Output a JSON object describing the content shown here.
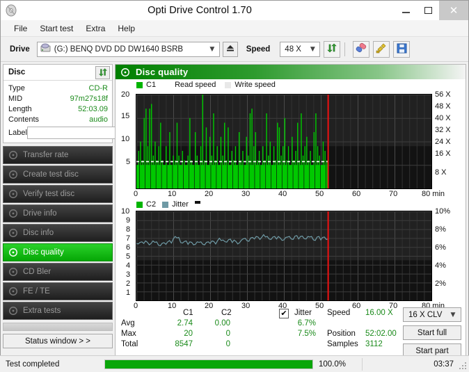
{
  "window": {
    "title": "Opti Drive Control 1.70",
    "app_icon": "disc-icon",
    "minimize": "minimize-icon",
    "maximize": "maximize-icon",
    "close": "close-icon"
  },
  "menu": {
    "items": [
      "File",
      "Start test",
      "Extra",
      "Help"
    ]
  },
  "toolbar": {
    "drive_label": "Drive",
    "drive_value": "(G:)   BENQ DVD DD DW1640 BSRB",
    "eject_icon": "eject-icon",
    "speed_label": "Speed",
    "speed_value": "48 X",
    "refresh_icon": "refresh-arrows-icon",
    "erase_icon": "eraser-icon",
    "tools_icon": "plug-icon",
    "save_icon": "floppy-save-icon"
  },
  "disc_panel": {
    "title": "Disc",
    "refresh_icon": "refresh-arrows-icon",
    "rows": [
      {
        "key": "Type",
        "value": "CD-R"
      },
      {
        "key": "MID",
        "value": "97m27s18f"
      },
      {
        "key": "Length",
        "value": "52:03.09"
      },
      {
        "key": "Contents",
        "value": "audio"
      }
    ],
    "label_key": "Label",
    "label_value": "",
    "label_placeholder": "",
    "label_button_icon": "cd-disc-icon"
  },
  "nav": {
    "items": [
      {
        "label": "Transfer rate",
        "icon": "disc-test-icon",
        "active": false
      },
      {
        "label": "Create test disc",
        "icon": "disc-burn-icon",
        "active": false
      },
      {
        "label": "Verify test disc",
        "icon": "disc-verify-icon",
        "active": false
      },
      {
        "label": "Drive info",
        "icon": "disc-drive-icon",
        "active": false
      },
      {
        "label": "Disc info",
        "icon": "disc-info-icon",
        "active": false
      },
      {
        "label": "Disc quality",
        "icon": "disc-quality-icon",
        "active": true
      },
      {
        "label": "CD Bler",
        "icon": "disc-bler-icon",
        "active": false
      },
      {
        "label": "FE / TE",
        "icon": "disc-fete-icon",
        "active": false
      },
      {
        "label": "Extra tests",
        "icon": "disc-extra-icon",
        "active": false
      }
    ],
    "status_window_label": "Status window > >"
  },
  "panel": {
    "title": "Disc quality",
    "icon": "disc-quality-icon"
  },
  "chart_data": [
    {
      "id": "c1-chart",
      "type": "bar",
      "title": "C1 / Read speed",
      "legend": [
        {
          "label": "C1",
          "color": "#00b400"
        },
        {
          "label": "Read speed",
          "color": "#ffffff"
        },
        {
          "label": "Write speed",
          "color": "#e8e8e8"
        }
      ],
      "legend_position": "top-left",
      "xlabel": "min",
      "xlim": [
        0,
        80
      ],
      "xticks": [
        0,
        10,
        20,
        30,
        40,
        50,
        60,
        70,
        80
      ],
      "xticklabels": [
        "0",
        "10",
        "20",
        "30",
        "40",
        "50",
        "60",
        "70",
        "80 min"
      ],
      "ylabel": "",
      "ylim": [
        0,
        20
      ],
      "yticks": [
        5,
        10,
        15,
        20
      ],
      "yticklabels": [
        "5",
        "10",
        "15",
        "20"
      ],
      "y2label": "",
      "y2lim": [
        0,
        56
      ],
      "y2ticks": [
        8,
        16,
        24,
        32,
        40,
        48,
        56
      ],
      "y2ticklabels": [
        "8 X",
        "16 X",
        "24 X",
        "32 X",
        "40 X",
        "48 X",
        "56 X"
      ],
      "grid": true,
      "marker_line_x": 52,
      "data_end_x": 52,
      "series": [
        {
          "name": "C1",
          "color": "#00c800",
          "x": [
            0,
            0.5,
            1,
            1.5,
            2,
            2.5,
            3,
            3.5,
            4,
            4.5,
            5,
            5.5,
            6,
            6.5,
            7,
            7.5,
            8,
            8.5,
            9,
            9.5,
            10,
            10.5,
            11,
            11.5,
            12,
            12.5,
            13,
            13.5,
            14,
            14.5,
            15,
            15.5,
            16,
            16.5,
            17,
            17.5,
            18,
            18.5,
            19,
            19.5,
            20,
            20.5,
            21,
            21.5,
            22,
            22.5,
            23,
            23.5,
            24,
            24.5,
            25,
            25.5,
            26,
            26.5,
            27,
            27.5,
            28,
            28.5,
            29,
            29.5,
            30,
            30.5,
            31,
            31.5,
            32,
            32.5,
            33,
            33.5,
            34,
            34.5,
            35,
            35.5,
            36,
            36.5,
            37,
            37.5,
            38,
            38.5,
            39,
            39.5,
            40,
            40.5,
            41,
            41.5,
            42,
            42.5,
            43,
            43.5,
            44,
            44.5,
            45,
            45.5,
            46,
            46.5,
            47,
            47.5,
            48,
            48.5,
            49,
            49.5,
            50,
            50.5,
            51,
            51.5,
            52
          ],
          "values": [
            5,
            8,
            10,
            6,
            15,
            17,
            9,
            17,
            18,
            7,
            10,
            6,
            9,
            14,
            6,
            5,
            9,
            4,
            12,
            5,
            7,
            6,
            14,
            7,
            5,
            8,
            6,
            5,
            7,
            15,
            6,
            5,
            12,
            7,
            5,
            9,
            20,
            6,
            13,
            5,
            11,
            7,
            16,
            6,
            9,
            5,
            11,
            7,
            14,
            6,
            13,
            5,
            8,
            6,
            9,
            5,
            12,
            6,
            8,
            5,
            11,
            7,
            16,
            17,
            9,
            12,
            6,
            8,
            5,
            9,
            6,
            16,
            7,
            10,
            5,
            9,
            6,
            14,
            13,
            7,
            9,
            15,
            6,
            9,
            5,
            11,
            6,
            8,
            14,
            6,
            16,
            7,
            9,
            11,
            6,
            8,
            5,
            12,
            16,
            9,
            7,
            5,
            10,
            8,
            6
          ]
        },
        {
          "name": "Read speed",
          "color": "#ffffff",
          "style": "dashed-line",
          "approx_value_x": 16.0,
          "note": "flat white dashed line around the 16 X level"
        }
      ],
      "avg": 2.74,
      "max": 20,
      "total": 8547
    },
    {
      "id": "c2-jitter-chart",
      "type": "line",
      "title": "C2 / Jitter",
      "legend": [
        {
          "label": "C2",
          "color": "#00b400"
        },
        {
          "label": "Jitter",
          "color": "#6f9aa5"
        }
      ],
      "legend_position": "top-left",
      "xlabel": "min",
      "xlim": [
        0,
        80
      ],
      "xticks": [
        0,
        10,
        20,
        30,
        40,
        50,
        60,
        70,
        80
      ],
      "xticklabels": [
        "0",
        "10",
        "20",
        "30",
        "40",
        "50",
        "60",
        "70",
        "80 min"
      ],
      "ylim": [
        0,
        10
      ],
      "yticks": [
        1,
        2,
        3,
        4,
        5,
        6,
        7,
        8,
        9,
        10
      ],
      "yticklabels": [
        "1",
        "2",
        "3",
        "4",
        "5",
        "6",
        "7",
        "8",
        "9",
        "10"
      ],
      "y2lim": [
        0,
        10
      ],
      "y2ticks": [
        2,
        4,
        6,
        8,
        10
      ],
      "y2ticklabels": [
        "2%",
        "4%",
        "6%",
        "8%",
        "10%"
      ],
      "grid": true,
      "marker_line_x": 52,
      "data_end_x": 52,
      "series": [
        {
          "name": "Jitter",
          "color": "#6f9aa5",
          "x": [
            0,
            1,
            2,
            3,
            4,
            5,
            6,
            7,
            8,
            9,
            10,
            11,
            12,
            13,
            14,
            15,
            16,
            17,
            18,
            19,
            20,
            21,
            22,
            23,
            24,
            25,
            26,
            27,
            28,
            29,
            30,
            31,
            32,
            33,
            34,
            35,
            36,
            37,
            38,
            39,
            40,
            41,
            42,
            43,
            44,
            45,
            46,
            47,
            48,
            49,
            50,
            51,
            52
          ],
          "values": [
            6.5,
            6.4,
            6.5,
            6.4,
            6.5,
            6.4,
            6.3,
            6.3,
            6.4,
            6.6,
            7.0,
            6.9,
            6.6,
            6.5,
            6.4,
            6.4,
            6.4,
            6.4,
            6.4,
            6.4,
            6.5,
            6.5,
            6.8,
            6.6,
            6.7,
            6.7,
            6.6,
            6.5,
            6.6,
            6.8,
            6.8,
            6.9,
            7.0,
            7.0,
            7.2,
            7.0,
            7.0,
            7.0,
            7.0,
            6.9,
            6.9,
            7.0,
            7.0,
            7.1,
            7.0,
            7.1,
            7.0,
            7.0,
            6.9,
            7.0,
            6.9,
            7.0,
            7.0
          ]
        },
        {
          "name": "C2",
          "color": "#00b400",
          "values": []
        }
      ],
      "avg": 6.7,
      "max": 7.5
    }
  ],
  "stats": {
    "col_headers": [
      "C1",
      "C2"
    ],
    "row_labels": [
      "Avg",
      "Max",
      "Total"
    ],
    "c1": {
      "avg": "2.74",
      "max": "20",
      "total": "8547"
    },
    "c2": {
      "avg": "0.00",
      "max": "0",
      "total": "0"
    },
    "jitter": {
      "label": "Jitter",
      "checked": true,
      "check_glyph": "✔",
      "avg": "6.7%",
      "max": "7.5%"
    },
    "info": [
      {
        "key": "Speed",
        "value": "16.00 X"
      },
      {
        "key": "Position",
        "value": "52:02.00"
      },
      {
        "key": "Samples",
        "value": "3112"
      }
    ],
    "speed_select": "16 X CLV",
    "start_full": "Start full",
    "start_part": "Start part"
  },
  "statusbar": {
    "message": "Test completed",
    "progress_percent": 100.0,
    "progress_text": "100.0%",
    "elapsed": "03:37"
  },
  "colors": {
    "accent_green": "#00a000",
    "value_green": "#1a8a1a",
    "marker_red": "#ee1111",
    "jitter_blue": "#6f9aa5",
    "plot_bg": "#121212"
  }
}
